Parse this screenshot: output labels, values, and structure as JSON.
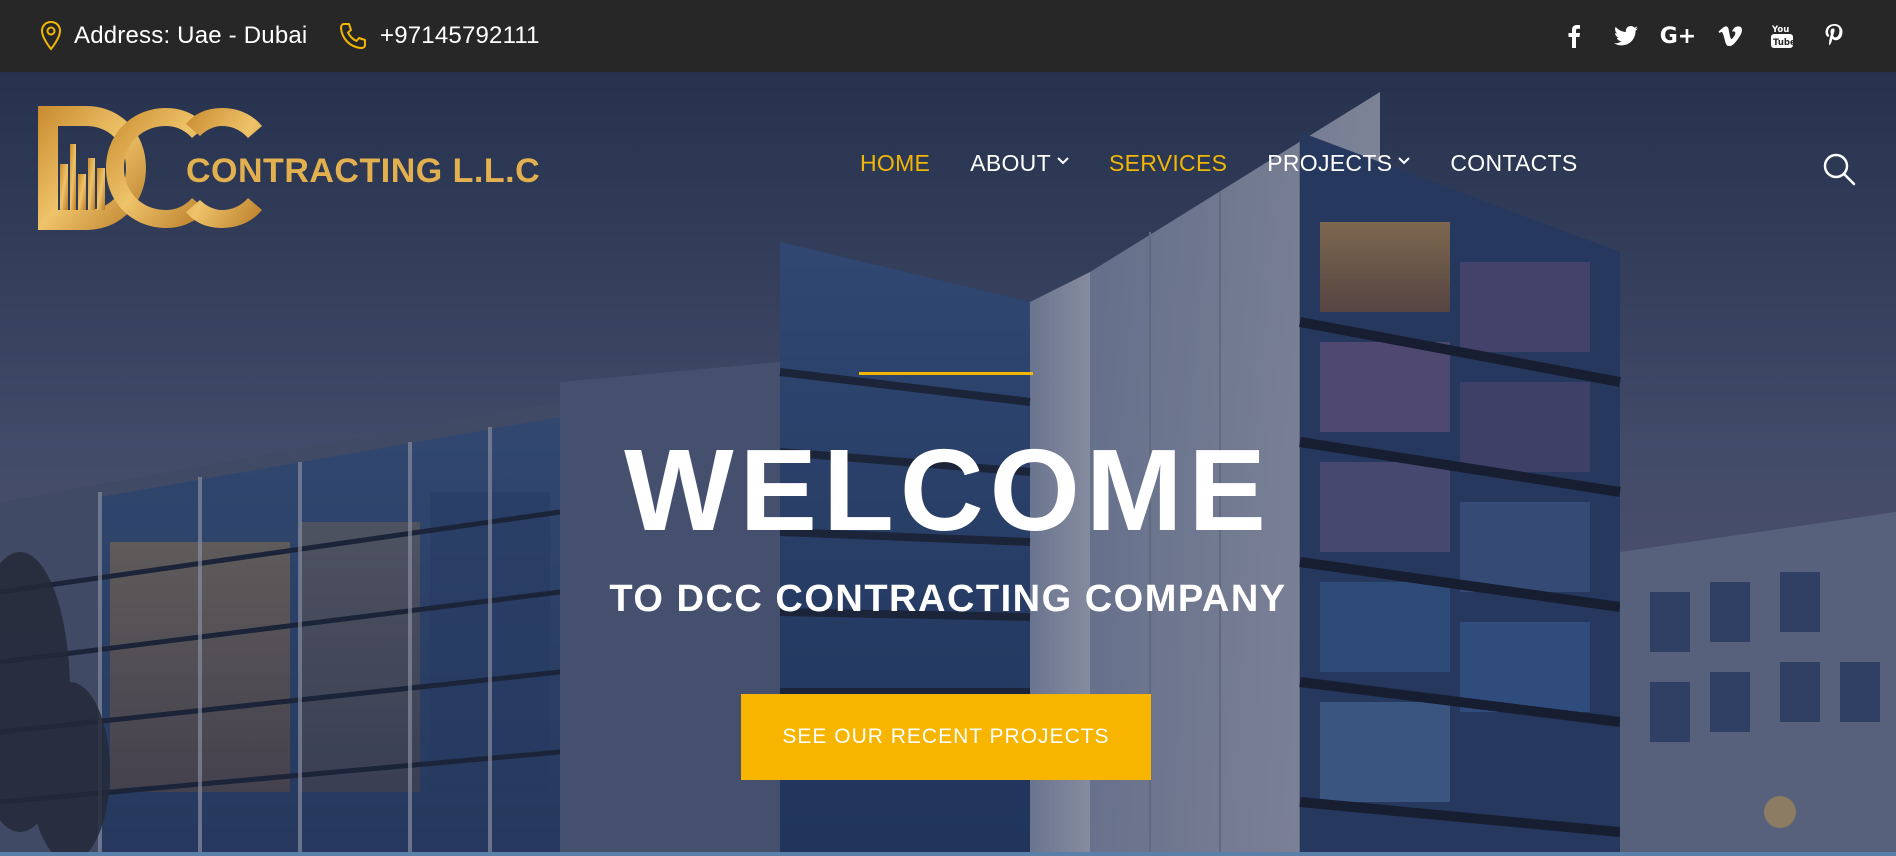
{
  "topbar": {
    "address": "Address: Uae - Dubai",
    "phone": "+97145792111",
    "address_icon": "map-pin-icon",
    "phone_icon": "phone-icon",
    "socials": [
      {
        "name": "facebook-icon",
        "glyph": "f"
      },
      {
        "name": "twitter-icon",
        "glyph": ""
      },
      {
        "name": "google-plus-icon",
        "glyph": "G+"
      },
      {
        "name": "vimeo-icon",
        "glyph": "v"
      },
      {
        "name": "youtube-icon",
        "glyph": ""
      },
      {
        "name": "pinterest-icon",
        "glyph": "p"
      }
    ]
  },
  "logo": {
    "mark": "DCC",
    "text": "CONTRACTING L.L.C"
  },
  "nav": {
    "items": [
      {
        "label": "HOME",
        "dropdown": false,
        "state": "active"
      },
      {
        "label": "ABOUT",
        "dropdown": true,
        "state": "normal"
      },
      {
        "label": "SERVICES",
        "dropdown": false,
        "state": "highlight"
      },
      {
        "label": "PROJECTS",
        "dropdown": true,
        "state": "normal"
      },
      {
        "label": "CONTACTS",
        "dropdown": false,
        "state": "normal"
      }
    ],
    "search_icon": "search-icon"
  },
  "hero": {
    "title": "WELCOME",
    "subtitle": "TO DCC CONTRACTING COMPANY",
    "cta_label": "SEE OUR RECENT PROJECTS"
  },
  "colors": {
    "accent": "#f2b705",
    "topbar_bg": "#272727",
    "logo_gold": "#e3b04f",
    "cta_bg": "#f7b500"
  }
}
